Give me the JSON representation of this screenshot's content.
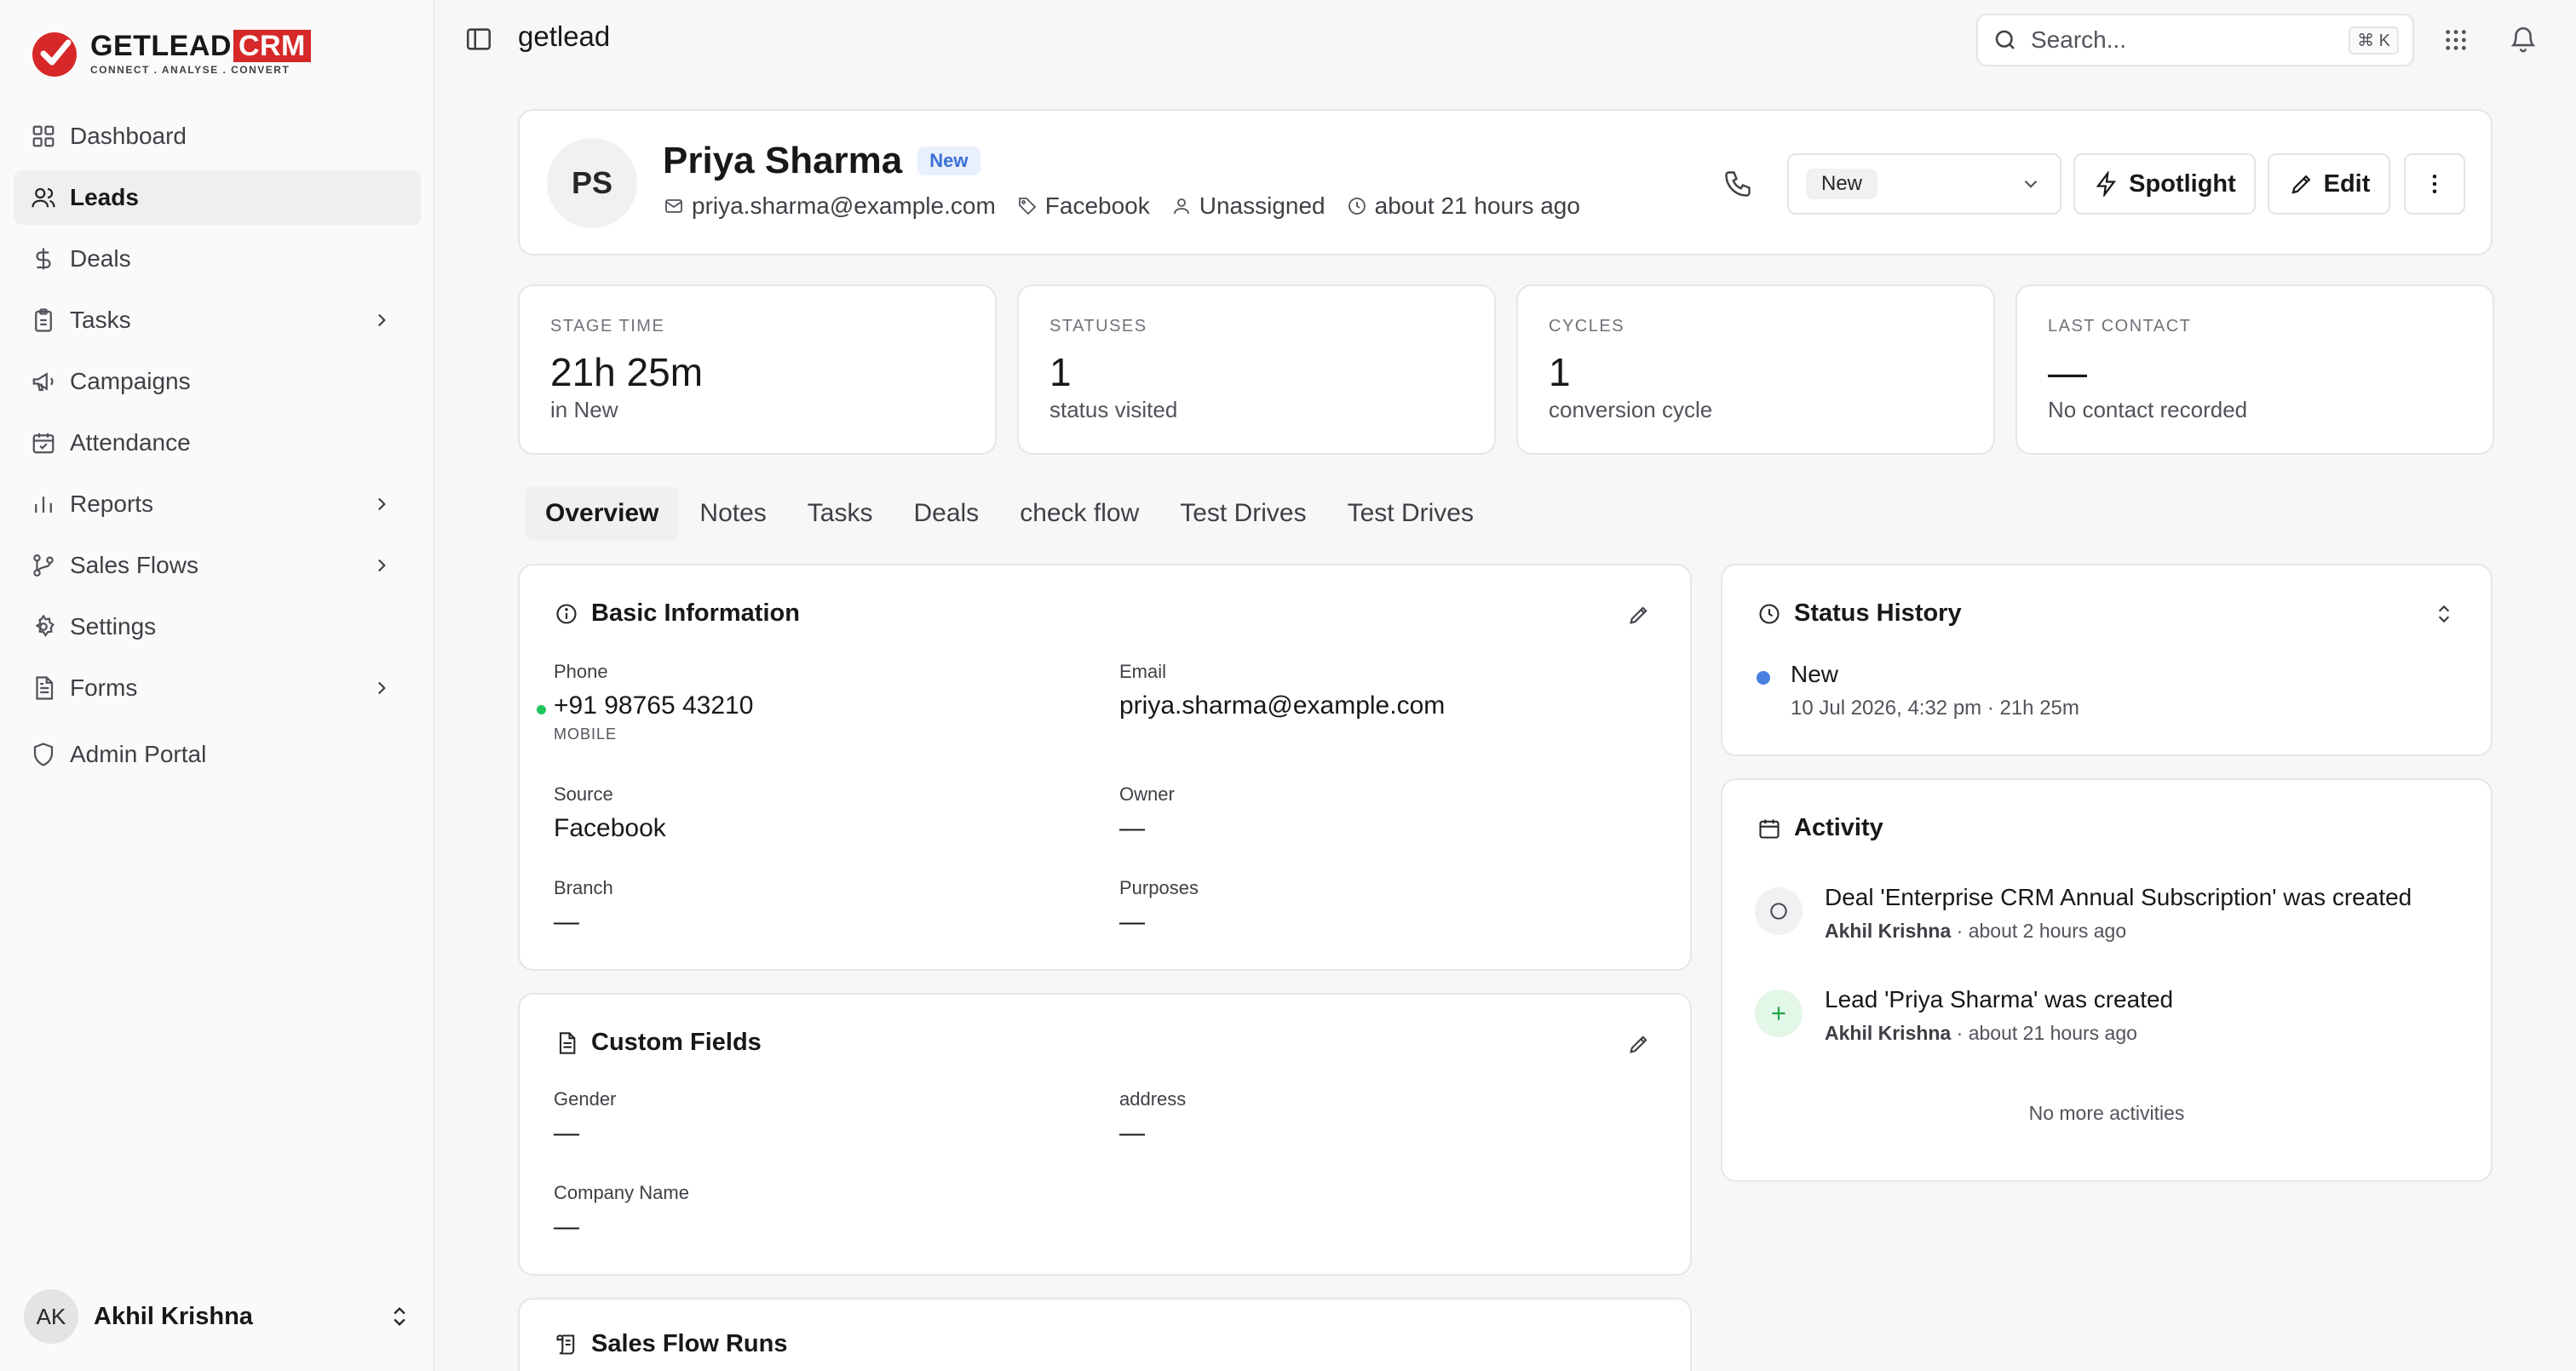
{
  "brand": {
    "name": "GETLEAD",
    "badge": "CRM",
    "tagline": "CONNECT . ANALYSE . CONVERT",
    "accent": "#d62828"
  },
  "sidebar": {
    "items": [
      {
        "label": "Dashboard",
        "icon": "grid-icon"
      },
      {
        "label": "Leads",
        "icon": "users-icon",
        "active": true
      },
      {
        "label": "Deals",
        "icon": "dollar-icon"
      },
      {
        "label": "Tasks",
        "icon": "clipboard-icon",
        "expandable": true
      },
      {
        "label": "Campaigns",
        "icon": "megaphone-icon"
      },
      {
        "label": "Attendance",
        "icon": "calendar-check-icon"
      },
      {
        "label": "Reports",
        "icon": "bar-chart-icon",
        "expandable": true
      },
      {
        "label": "Sales Flows",
        "icon": "git-branch-icon",
        "expandable": true
      },
      {
        "label": "Settings",
        "icon": "gear-icon"
      },
      {
        "label": "Forms",
        "icon": "file-text-icon",
        "expandable": true
      },
      {
        "label": "Admin Portal",
        "icon": "shield-icon"
      }
    ],
    "user": {
      "initials": "AK",
      "name": "Akhil Krishna"
    }
  },
  "topbar": {
    "breadcrumb": "getlead",
    "search_placeholder": "Search...",
    "search_shortcut": "⌘ K"
  },
  "lead": {
    "initials": "PS",
    "name": "Priya Sharma",
    "status_badge": "New",
    "email": "priya.sharma@example.com",
    "source": "Facebook",
    "owner": "Unassigned",
    "created": "about 21 hours ago",
    "status_select": "New",
    "actions": {
      "spotlight": "Spotlight",
      "edit": "Edit"
    }
  },
  "stats": [
    {
      "label": "STAGE TIME",
      "value": "21h 25m",
      "sub": "in New"
    },
    {
      "label": "STATUSES",
      "value": "1",
      "sub": "status visited"
    },
    {
      "label": "CYCLES",
      "value": "1",
      "sub": "conversion cycle"
    },
    {
      "label": "LAST CONTACT",
      "value": "—",
      "sub": "No contact recorded"
    }
  ],
  "tabs": [
    "Overview",
    "Notes",
    "Tasks",
    "Deals",
    "check flow",
    "Test Drives",
    "Test Drives"
  ],
  "basic_info": {
    "title": "Basic Information",
    "phone_label": "Phone",
    "phone_value": "+91 98765 43210",
    "phone_type": "MOBILE",
    "email_label": "Email",
    "email_value": "priya.sharma@example.com",
    "source_label": "Source",
    "source_value": "Facebook",
    "owner_label": "Owner",
    "owner_value": "—",
    "branch_label": "Branch",
    "branch_value": "—",
    "purposes_label": "Purposes",
    "purposes_value": "—"
  },
  "custom_fields": {
    "title": "Custom Fields",
    "gender_label": "Gender",
    "gender_value": "—",
    "address_label": "address",
    "address_value": "—",
    "company_label": "Company Name",
    "company_value": "—"
  },
  "sales_flow": {
    "title": "Sales Flow Runs"
  },
  "status_history": {
    "title": "Status History",
    "items": [
      {
        "status": "New",
        "meta": "10 Jul 2026, 4:32 pm · 21h 25m"
      }
    ]
  },
  "activity": {
    "title": "Activity",
    "items": [
      {
        "title": "Deal 'Enterprise CRM Annual Subscription' was created",
        "author": "Akhil Krishna",
        "time": "about 2 hours ago"
      },
      {
        "title": "Lead 'Priya Sharma' was created",
        "author": "Akhil Krishna",
        "time": "about 21 hours ago"
      }
    ],
    "footer": "No more activities"
  }
}
